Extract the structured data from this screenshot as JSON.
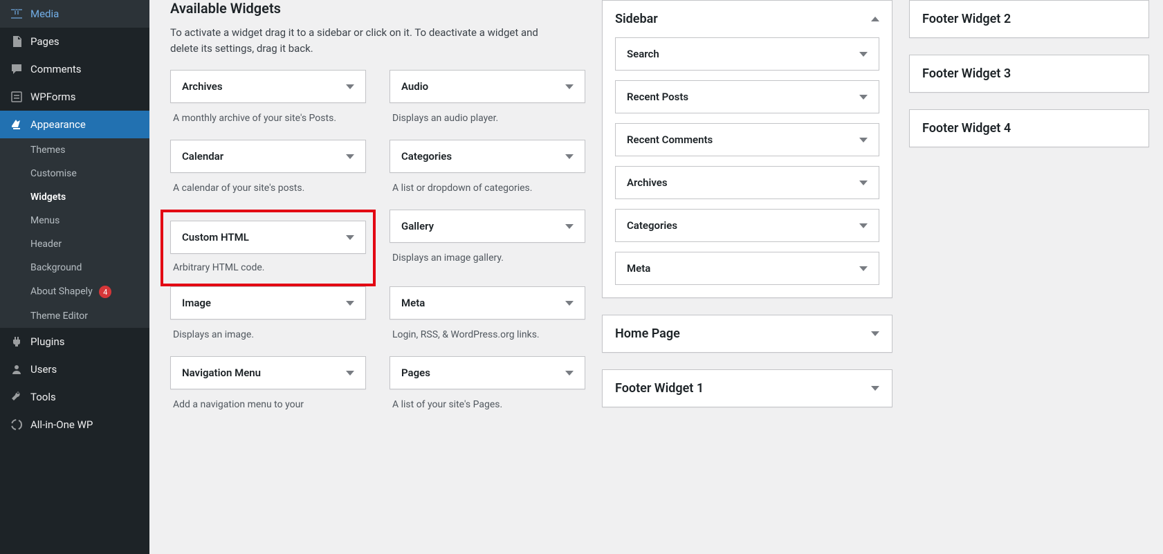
{
  "menu": {
    "media": "Media",
    "pages": "Pages",
    "comments": "Comments",
    "wpforms": "WPForms",
    "appearance": "Appearance",
    "plugins": "Plugins",
    "users": "Users",
    "tools": "Tools",
    "allinone": "All-in-One WP"
  },
  "submenu": {
    "themes": "Themes",
    "customise": "Customise",
    "widgets": "Widgets",
    "menus": "Menus",
    "header": "Header",
    "background": "Background",
    "about_shapely": "About Shapely",
    "about_shapely_count": "4",
    "theme_editor": "Theme Editor"
  },
  "heading": "Available Widgets",
  "description": "To activate a widget drag it to a sidebar or click on it. To deactivate a widget and delete its settings, drag it back.",
  "widgets": {
    "archives": {
      "title": "Archives",
      "desc": "A monthly archive of your site's Posts."
    },
    "audio": {
      "title": "Audio",
      "desc": "Displays an audio player."
    },
    "calendar": {
      "title": "Calendar",
      "desc": "A calendar of your site's posts."
    },
    "categories": {
      "title": "Categories",
      "desc": "A list or dropdown of categories."
    },
    "custom_html": {
      "title": "Custom HTML",
      "desc": "Arbitrary HTML code."
    },
    "gallery": {
      "title": "Gallery",
      "desc": "Displays an image gallery."
    },
    "image": {
      "title": "Image",
      "desc": "Displays an image."
    },
    "meta": {
      "title": "Meta",
      "desc": "Login, RSS, & WordPress.org links."
    },
    "navigation": {
      "title": "Navigation Menu",
      "desc": "Add a navigation menu to your"
    },
    "pages": {
      "title": "Pages",
      "desc": "A list of your site's Pages."
    }
  },
  "areas": {
    "sidebar": {
      "title": "Sidebar",
      "items": [
        "Search",
        "Recent Posts",
        "Recent Comments",
        "Archives",
        "Categories",
        "Meta"
      ]
    },
    "home_page": "Home Page",
    "footer1": "Footer Widget 1",
    "footer2": "Footer Widget 2",
    "footer3": "Footer Widget 3",
    "footer4": "Footer Widget 4"
  }
}
